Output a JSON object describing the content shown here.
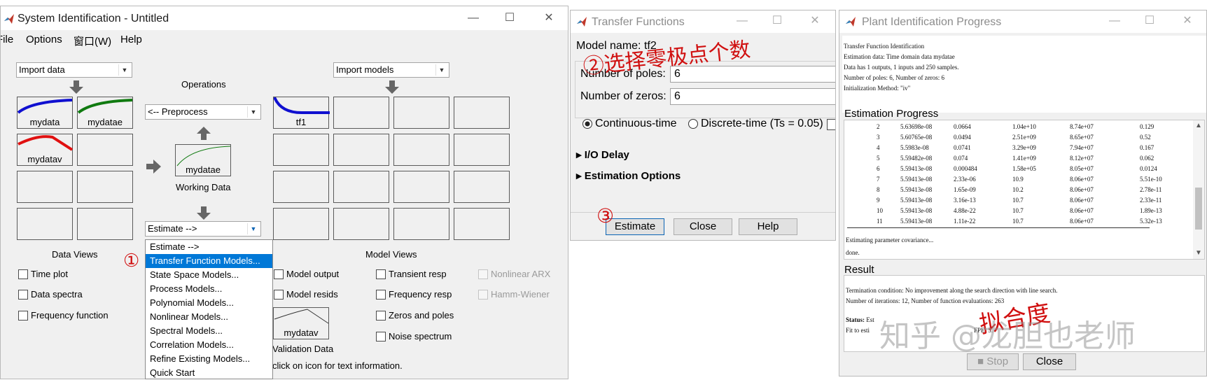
{
  "sysid": {
    "title": "System Identification - Untitled",
    "menu": [
      "File",
      "Options",
      "窗口(W)",
      "Help"
    ],
    "import_data": "Import data",
    "import_models": "Import models",
    "operations_label": "Operations",
    "preprocess": "<-- Preprocess",
    "working_data_name": "mydatae",
    "working_data_label": "Working Data",
    "estimate": "Estimate -->",
    "data_tiles": [
      "mydata",
      "mydatae",
      "mydatav"
    ],
    "model_tiles": [
      "tf1"
    ],
    "validation_name": "mydatav",
    "validation_label": "Validation Data",
    "data_views_label": "Data Views",
    "model_views_label": "Model Views",
    "data_views": [
      "Time plot",
      "Data spectra",
      "Frequency function"
    ],
    "model_views_col1": [
      "Model output",
      "Model resids"
    ],
    "model_views_col2": [
      "Transient resp",
      "Frequency resp",
      "Zeros and poles",
      "Noise spectrum"
    ],
    "model_views_col3": [
      "Nonlinear ARX",
      "Hamm-Wiener"
    ],
    "status_text": "click on icon for text information.",
    "estimate_menu": [
      "Estimate -->",
      "Transfer Function Models...",
      "State Space Models...",
      "Process Models...",
      "Polynomial Models...",
      "Nonlinear Models...",
      "Spectral Models...",
      "Correlation Models...",
      "Refine Existing Models...",
      "Quick Start"
    ],
    "selected_menu_item": "Transfer Function Models..."
  },
  "tf": {
    "title": "Transfer Functions",
    "model_name_label": "Model name: tf2",
    "poles_label": "Number of poles:",
    "poles_value": "6",
    "zeros_label": "Number of zeros:",
    "zeros_value": "6",
    "continuous": "Continuous-time",
    "discrete": "Discrete-time (Ts = 0.05)",
    "io_delay": "I/O Delay",
    "estimation_options": "Estimation Options",
    "estimate_btn": "Estimate",
    "close_btn": "Close",
    "help_btn": "Help"
  },
  "progress": {
    "title": "Plant Identification Progress",
    "header_lines": [
      "Transfer Function Identification",
      "Estimation data: Time domain data mydatae",
      "Data has 1 outputs, 1 inputs and 250 samples.",
      "Number of poles: 6, Number of zeros: 6",
      "Initialization Method: \"iv\""
    ],
    "estimation_progress_label": "Estimation Progress",
    "rows": [
      [
        "2",
        "5.63698e-08",
        "0.0664",
        "1.04e+10",
        "8.74e+07",
        "0.129"
      ],
      [
        "3",
        "5.60765e-08",
        "0.0494",
        "2.51e+09",
        "8.65e+07",
        "0.52"
      ],
      [
        "4",
        "5.5983e-08",
        "0.0741",
        "3.29e+09",
        "7.94e+07",
        "0.167"
      ],
      [
        "5",
        "5.59482e-08",
        "0.074",
        "1.41e+09",
        "8.12e+07",
        "0.062"
      ],
      [
        "6",
        "5.59413e-08",
        "0.000484",
        "1.58e+05",
        "8.05e+07",
        "0.0124"
      ],
      [
        "7",
        "5.59413e-08",
        "2.33e-06",
        "10.9",
        "8.06e+07",
        "5.51e-10"
      ],
      [
        "8",
        "5.59413e-08",
        "1.65e-09",
        "10.2",
        "8.06e+07",
        "2.78e-11"
      ],
      [
        "9",
        "5.59413e-08",
        "3.16e-13",
        "10.7",
        "8.06e+07",
        "2.33e-11"
      ],
      [
        "10",
        "5.59413e-08",
        "4.88e-22",
        "10.7",
        "8.06e+07",
        "1.89e-13"
      ],
      [
        "11",
        "5.59413e-08",
        "1.11e-22",
        "10.7",
        "8.06e+07",
        "5.32e-13"
      ]
    ],
    "footer_lines": [
      "Estimating parameter covariance...",
      "done."
    ],
    "result_label": "Result",
    "result_lines": [
      "Termination condition: No improvement along the search direction with line search.",
      "Number of iterations: 12, Number of function evaluations: 263"
    ],
    "status_line_bold": "Status:",
    "status_line_rest": "Est",
    "fit_line": "Fit to esti",
    "fpe_text": "FPE: 5.",
    "stop_btn": "Stop",
    "close_btn": "Close"
  },
  "annotations": {
    "circle1": "①",
    "note2": "②选择零极点个数",
    "circle3": "③",
    "fit_note": "拟合度",
    "watermark": "知乎 @龙胆也老师"
  },
  "colors": {
    "blue_curve": "#1010d0",
    "green_curve": "#107a10",
    "red_curve": "#e01010",
    "menu_highlight": "#0078d7",
    "annotation_red": "#d01010"
  }
}
